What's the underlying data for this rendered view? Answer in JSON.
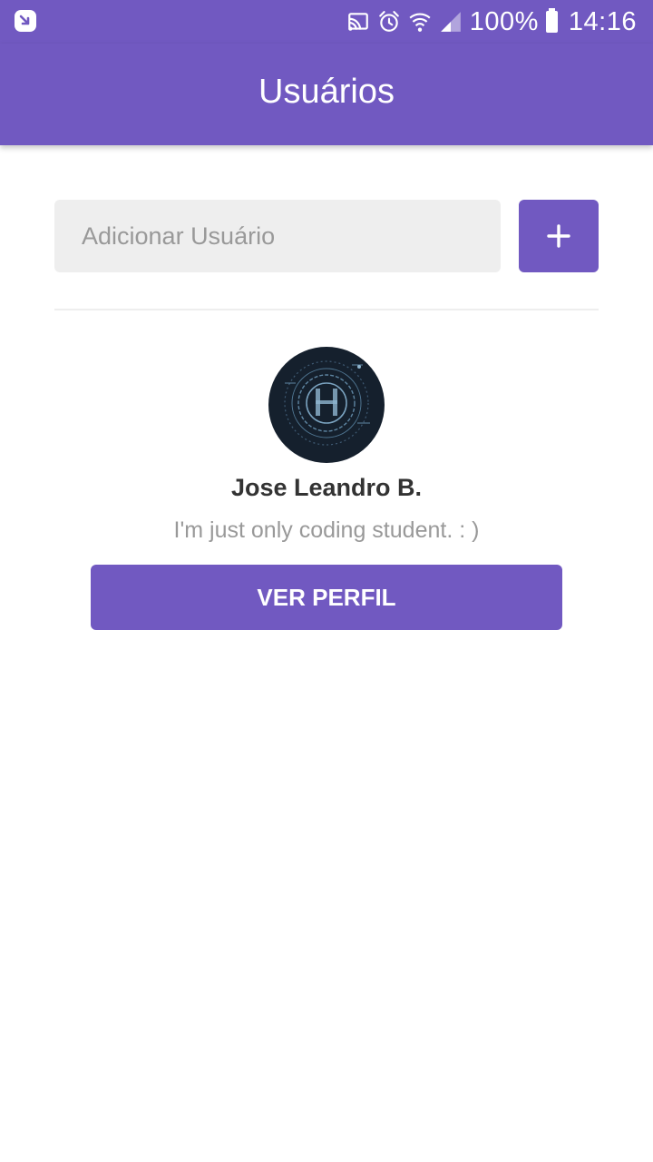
{
  "status_bar": {
    "battery": "100%",
    "time": "14:16",
    "icons": [
      "app-notification-icon",
      "cast-icon",
      "alarm-icon",
      "wifi-icon",
      "signal-icon",
      "battery-icon"
    ]
  },
  "app_bar": {
    "title": "Usuários"
  },
  "form": {
    "input_placeholder": "Adicionar Usuário",
    "input_value": "",
    "add_icon": "plus-icon"
  },
  "users": [
    {
      "name": "Jose Leandro B.",
      "bio": "I'm just only coding student. : )",
      "button_label": "VER PERFIL",
      "avatar": "avatar-image"
    }
  ],
  "colors": {
    "primary": "#7159c1",
    "input_background": "#eeeeee",
    "name_text": "#333333",
    "bio_text": "#999999",
    "avatar_background": "#15202d"
  }
}
